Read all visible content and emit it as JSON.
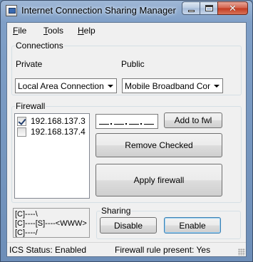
{
  "window": {
    "title": "Internet Connection Sharing Manager"
  },
  "menu": {
    "file": "File",
    "tools": "Tools",
    "help": "Help"
  },
  "connections": {
    "group_label": "Connections",
    "private_label": "Private",
    "public_label": "Public",
    "private_selected": "Local Area Connection",
    "public_selected": "Mobile Broadband Conne"
  },
  "firewall": {
    "group_label": "Firewall",
    "items": [
      {
        "address": "192.168.137.3",
        "checked": true
      },
      {
        "address": "192.168.137.4",
        "checked": false
      }
    ],
    "add_button": "Add to fwl",
    "remove_button": "Remove Checked",
    "apply_button": "Apply firewall"
  },
  "diagram": {
    "line1": "[C]----\\",
    "line2": "[C]----[S]----<WWW>",
    "line3": "[C]----/"
  },
  "sharing": {
    "group_label": "Sharing",
    "disable_button": "Disable",
    "enable_button": "Enable"
  },
  "status": {
    "ics_status": "ICS Status: Enabled",
    "firewall_rule": "Firewall rule present: Yes"
  }
}
